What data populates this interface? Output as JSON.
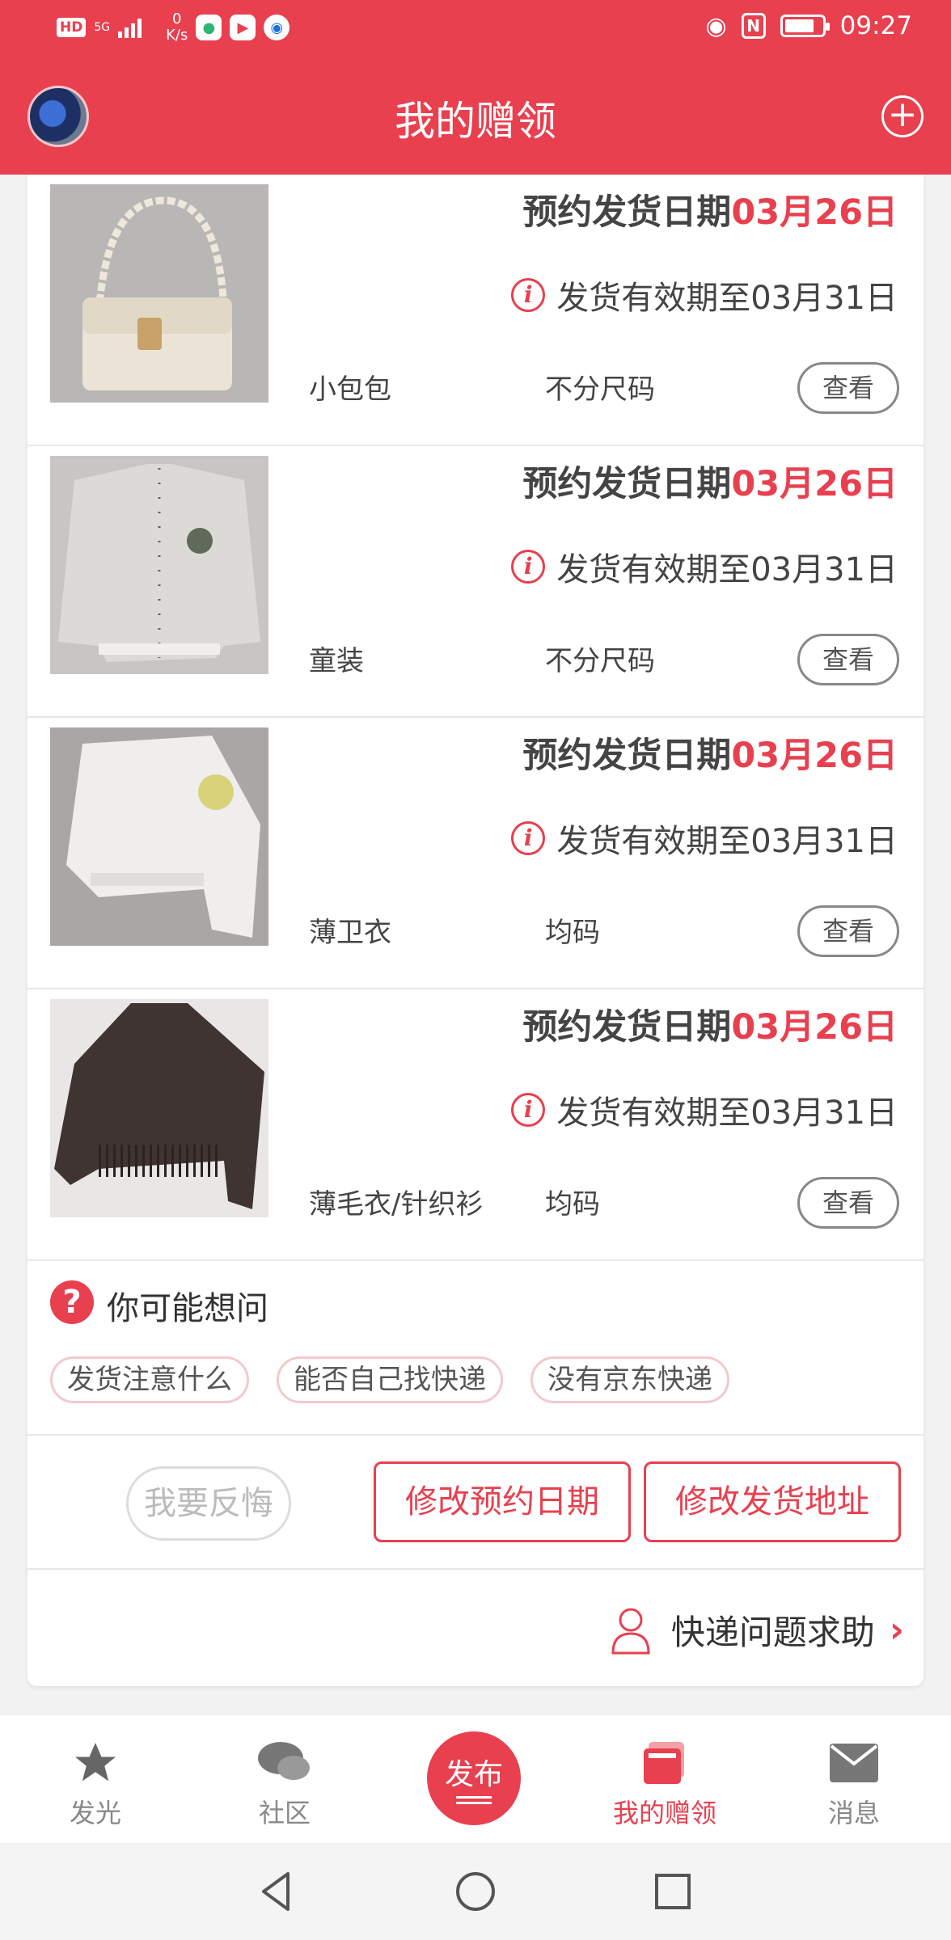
{
  "status_bar": {
    "hd": "HD",
    "network": "5G",
    "speed_value": "0",
    "speed_unit": "K/s",
    "time": "09:27",
    "nfc": "N"
  },
  "header": {
    "title": "我的赠领",
    "add_icon": "plus-circle-icon"
  },
  "items": [
    {
      "date_prefix": "预约发货日期",
      "date": "03月26日",
      "valid": "发货有效期至03月31日",
      "name": "小包包",
      "size": "不分尺码",
      "view": "查看"
    },
    {
      "date_prefix": "预约发货日期",
      "date": "03月26日",
      "valid": "发货有效期至03月31日",
      "name": "童装",
      "size": "不分尺码",
      "view": "查看"
    },
    {
      "date_prefix": "预约发货日期",
      "date": "03月26日",
      "valid": "发货有效期至03月31日",
      "name": "薄卫衣",
      "size": "均码",
      "view": "查看"
    },
    {
      "date_prefix": "预约发货日期",
      "date": "03月26日",
      "valid": "发货有效期至03月31日",
      "name": "薄毛衣/针织衫",
      "size": "均码",
      "view": "查看"
    }
  ],
  "faq": {
    "icon_text": "?",
    "title": "你可能想问",
    "tags": [
      "发货注意什么",
      "能否自己找快递",
      "没有京东快递"
    ]
  },
  "actions": {
    "regret": "我要反悔",
    "change_date": "修改预约日期",
    "change_address": "修改发货地址"
  },
  "help": {
    "label": "快递问题求助",
    "chevron": "›"
  },
  "bottom_nav": {
    "items": [
      {
        "label": "发光",
        "icon": "star-icon"
      },
      {
        "label": "社区",
        "icon": "chat-bubbles-icon"
      },
      {
        "label": "发布",
        "icon": "publish-icon"
      },
      {
        "label": "我的赠领",
        "icon": "gift-box-icon"
      },
      {
        "label": "消息",
        "icon": "mail-icon"
      }
    ]
  },
  "colors": {
    "primary": "#e8404f",
    "text": "#333333",
    "muted": "#888888"
  }
}
